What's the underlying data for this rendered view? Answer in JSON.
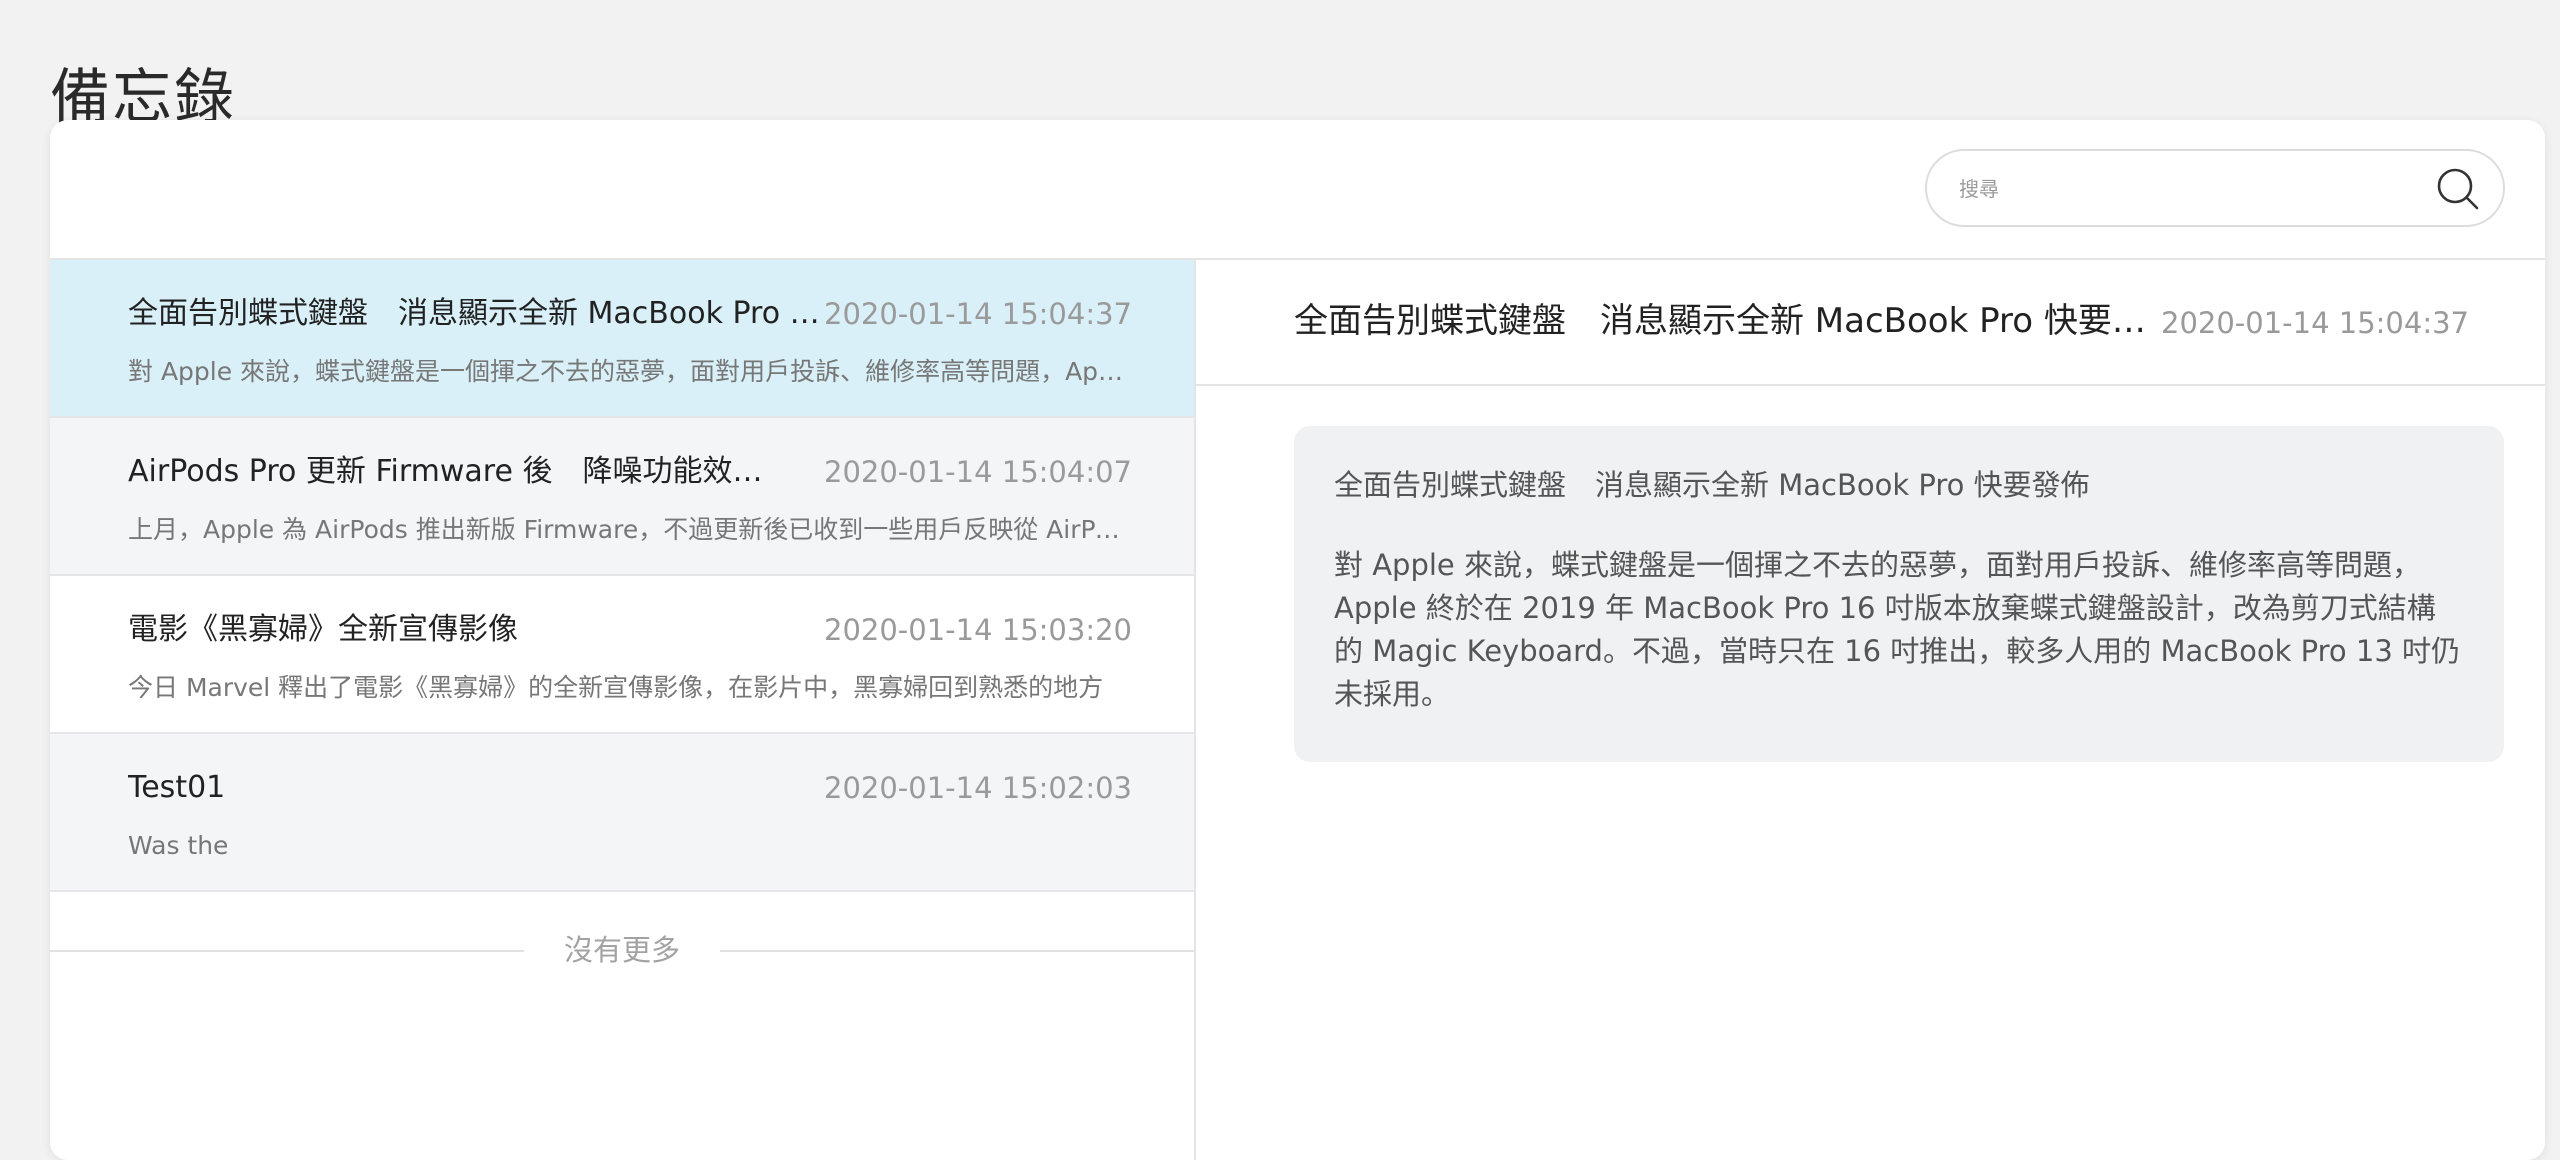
{
  "page": {
    "title": "備忘錄"
  },
  "search": {
    "placeholder": "搜尋"
  },
  "notes": [
    {
      "title": "全面告別蝶式鍵盤　消息顯示全新 MacBook Pro 快要發佈",
      "time": "2020-01-14 15:04:37",
      "preview": "對 Apple 來說，蝶式鍵盤是一個揮之不去的惡夢，面對用戶投訴、維修率高等問題，Apple 終於在 2019 年 MacBook Pro 16 吋版本放棄蝶式鍵盤設計"
    },
    {
      "title": "AirPods Pro 更新 Firmware 後　降噪功能效果變差",
      "time": "2020-01-14 15:04:07",
      "preview": "上月，Apple 為 AirPods 推出新版 Firmware，不過更新後已收到一些用戶反映從 AirPods Pro 降噪效果"
    },
    {
      "title": "電影《黑寡婦》全新宣傳影像",
      "time": "2020-01-14 15:03:20",
      "preview": "今日 Marvel 釋出了電影《黑寡婦》的全新宣傳影像，在影片中，黑寡婦回到熟悉的地方"
    },
    {
      "title": "Test01",
      "time": "2020-01-14 15:02:03",
      "preview": "Was the"
    }
  ],
  "list_footer": {
    "no_more": "沒有更多"
  },
  "detail": {
    "title": "全面告別蝶式鍵盤　消息顯示全新 MacBook Pro 快要發佈",
    "time": "2020-01-14 15:04:37",
    "body_title": "全面告別蝶式鍵盤　消息顯示全新 MacBook Pro 快要發佈",
    "body_text": "對 Apple 來說，蝶式鍵盤是一個揮之不去的惡夢，面對用戶投訴、維修率高等問題，Apple 終於在 2019 年 MacBook Pro 16 吋版本放棄蝶式鍵盤設計，改為剪刀式結構的 Magic Keyboard。不過，當時只在 16 吋推出，較多人用的 MacBook Pro 13 吋仍未採用。"
  },
  "colors": {
    "selected_row": "#d9f0f8",
    "unselected_row": "#f4f5f7",
    "background": "#f2f2f3"
  },
  "icons": {
    "search": "search-icon"
  }
}
